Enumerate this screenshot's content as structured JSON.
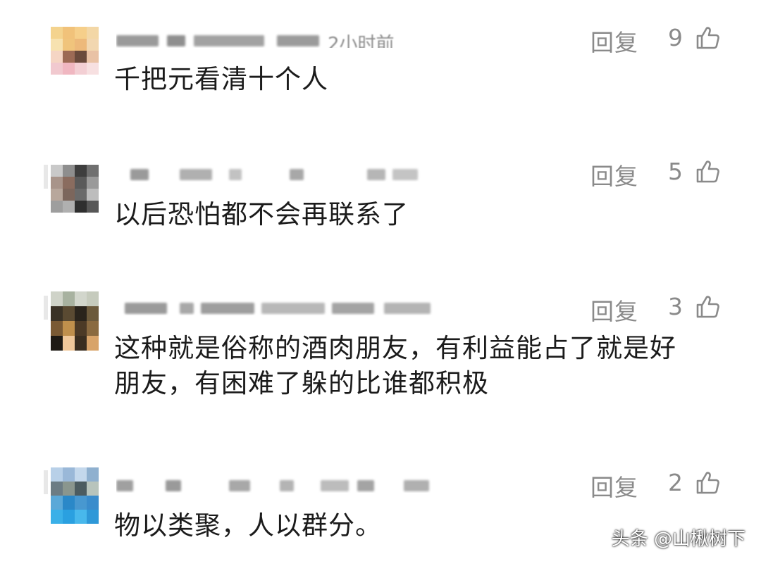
{
  "comments": [
    {
      "meta_visible": "2小时前",
      "text": "千把元看清十个人",
      "reply_label": "回复",
      "likes": "9"
    },
    {
      "text": "以后恐怕都不会再联系了",
      "reply_label": "回复",
      "likes": "5"
    },
    {
      "text": "这种就是俗称的酒肉朋友，有利益能占了就是好\n朋友，有困难了躲的比谁都积极",
      "reply_label": "回复",
      "likes": "3"
    },
    {
      "text": "物以类聚，人以群分。",
      "reply_label": "回复",
      "likes": "2"
    }
  ],
  "watermark": "头条 @山楸树下",
  "icons": {
    "like": "thumbs-up-outline-icon"
  },
  "colors": {
    "text": "#1b1b1b",
    "secondary": "#8a8a8a",
    "background": "#ffffff"
  }
}
